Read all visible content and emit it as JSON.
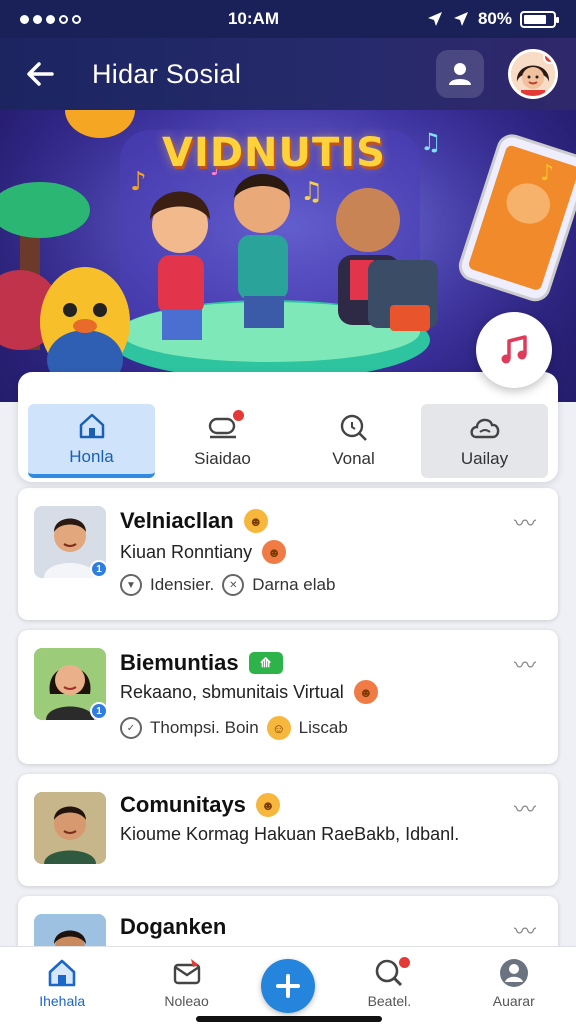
{
  "status": {
    "time": "10:AM",
    "battery": "80%"
  },
  "header": {
    "title": "Hidar Sosial"
  },
  "banner": {
    "title": "VIDNUTIS"
  },
  "tabs": [
    {
      "label": "Honla",
      "icon": "home-icon"
    },
    {
      "label": "Siaidao",
      "icon": "chat-icon"
    },
    {
      "label": "Vonal",
      "icon": "search-icon"
    },
    {
      "label": "Uailay",
      "icon": "cloud-icon"
    }
  ],
  "feed": [
    {
      "name": "Velniacllan",
      "subtitle": "Kiuan Ronntiany",
      "meta1": "Idensier.",
      "meta2": "Darna elab"
    },
    {
      "name": "Biemuntias",
      "subtitle": "Rekaano, sbmunitais Virtual",
      "meta1": "Thompsi. Boin",
      "meta2": "Liscab"
    },
    {
      "name": "Comunitays",
      "subtitle": "Kioume Kormag Hakuan RaeBakb, Idbanl.",
      "meta1": "",
      "meta2": ""
    },
    {
      "name": "Doganken",
      "subtitle": "",
      "meta1": "",
      "meta2": ""
    }
  ],
  "bottom_nav": [
    {
      "label": "Ihehala",
      "icon": "home-icon"
    },
    {
      "label": "Noleao",
      "icon": "notification-icon"
    },
    {
      "label": "Beatel.",
      "icon": "search-icon"
    },
    {
      "label": "Auarar",
      "icon": "avatar-icon"
    }
  ],
  "colors": {
    "header_bg": "#1c2560",
    "accent_blue": "#2585dd",
    "badge_red": "#e53935",
    "active_tab_bg": "#cfe4fb"
  }
}
